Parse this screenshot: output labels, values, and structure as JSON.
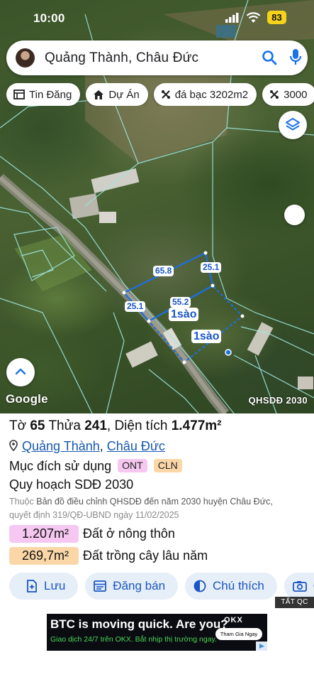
{
  "status_bar": {
    "time": "10:00",
    "battery": "83"
  },
  "search": {
    "query": "Quảng Thành, Châu Đức"
  },
  "chips": [
    {
      "icon": "table-icon",
      "label": "Tin Đăng"
    },
    {
      "icon": "house-icon",
      "label": "Dự Án"
    },
    {
      "icon": "measure-icon",
      "label": "đá bạc 3202m2"
    },
    {
      "icon": "measure-icon",
      "label": "3000"
    }
  ],
  "map": {
    "labels": {
      "top_edge": "65.8",
      "right_edge": "25.1",
      "left_edge": "25.1",
      "middle_edge": "55.2",
      "plot_a": "1sào",
      "plot_b": "1sào"
    },
    "attribution": "Google",
    "layer_badge": "QHSDĐ 2030",
    "colors": {
      "parcel_outline": "#1e6fe0",
      "grid_lines": "#9fe7e0"
    }
  },
  "parcel": {
    "sheet_label": "Tờ",
    "sheet": "65",
    "plot_label": "Thửa",
    "plot": "241",
    "area_label": "Diện tích",
    "area": "1.477m²",
    "ward": "Quảng Thành",
    "district": "Châu Đức",
    "sep": ",",
    "purpose_label": "Mục đích sử dụng",
    "purpose_tags": [
      "ONT",
      "CLN"
    ],
    "plan": "Quy hoạch SDĐ 2030",
    "note_prefix": "Thuộc",
    "note_body": "Bản đồ điều chỉnh QHSDĐ đến năm 2030 huyện Châu Đức,",
    "note_line2": "quyết định 319/QĐ-UBND ngày 11/02/2025",
    "areas": [
      {
        "value": "1.207m²",
        "label": "Đất ở nông thôn",
        "color": "#f6c8f1"
      },
      {
        "value": "269,7m²",
        "label": "Đất trồng cây lâu năm",
        "color": "#fbd7a8"
      }
    ]
  },
  "actions": [
    {
      "icon": "save-icon",
      "label": "Lưu"
    },
    {
      "icon": "listing-icon",
      "label": "Đăng bán"
    },
    {
      "icon": "legend-icon",
      "label": "Chú thích"
    },
    {
      "icon": "camera-icon",
      "label": "C"
    }
  ],
  "ad_tag": "TẤT QC",
  "ad": {
    "headline": "BTC is moving quick. Are you?",
    "subline": "Giao dịch 24/7 trên OKX. Bắt nhịp thị trường ngay.",
    "brand": "OKX",
    "cta": "Tham Gia Ngay"
  }
}
